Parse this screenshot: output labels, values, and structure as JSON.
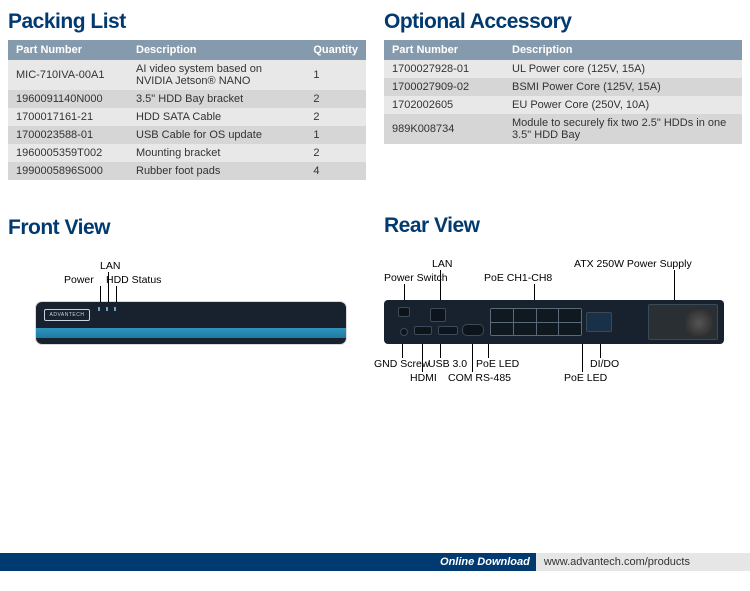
{
  "sections": {
    "packing": "Packing List",
    "optional": "Optional Accessory",
    "front": "Front View",
    "rear": "Rear View"
  },
  "packing": {
    "headers": {
      "pn": "Part Number",
      "desc": "Description",
      "qty": "Quantity"
    },
    "rows": [
      {
        "pn": "MIC-710IVA-00A1",
        "desc": "AI video system based on NVIDIA Jetson® NANO",
        "qty": "1"
      },
      {
        "pn": "1960091140N000",
        "desc": "3.5\" HDD Bay bracket",
        "qty": "2"
      },
      {
        "pn": "1700017161-21",
        "desc": "HDD SATA Cable",
        "qty": "2"
      },
      {
        "pn": "1700023588-01",
        "desc": "USB Cable for OS update",
        "qty": "1"
      },
      {
        "pn": "1960005359T002",
        "desc": "Mounting bracket",
        "qty": "2"
      },
      {
        "pn": "1990005896S000",
        "desc": "Rubber foot pads",
        "qty": "4"
      }
    ]
  },
  "optional": {
    "headers": {
      "pn": "Part Number",
      "desc": "Description"
    },
    "rows": [
      {
        "pn": "1700027928-01",
        "desc": "UL Power core (125V, 15A)"
      },
      {
        "pn": "1700027909-02",
        "desc": "BSMI Power Core (125V, 15A)"
      },
      {
        "pn": "1702002605",
        "desc": "EU Power Core (250V, 10A)"
      },
      {
        "pn": "989K008734",
        "desc": "Module to securely fix two 2.5\" HDDs in one 3.5\" HDD Bay"
      }
    ]
  },
  "front_labels": {
    "power": "Power",
    "lan": "LAN",
    "hdd": "HDD Status",
    "logo": "ADVANTECH"
  },
  "rear_labels": {
    "power_switch": "Power Switch",
    "lan": "LAN",
    "poe_ch": "PoE CH1-CH8",
    "psu": "ATX 250W Power Supply",
    "gnd": "GND Screw",
    "hdmi": "HDMI",
    "usb": "USB 3.0",
    "com": "COM RS-485",
    "poe_led": "PoE LED",
    "poe_led2": "PoE LED",
    "dido": "DI/DO"
  },
  "footer": {
    "label": "Online Download",
    "url": "www.advantech.com/products"
  }
}
